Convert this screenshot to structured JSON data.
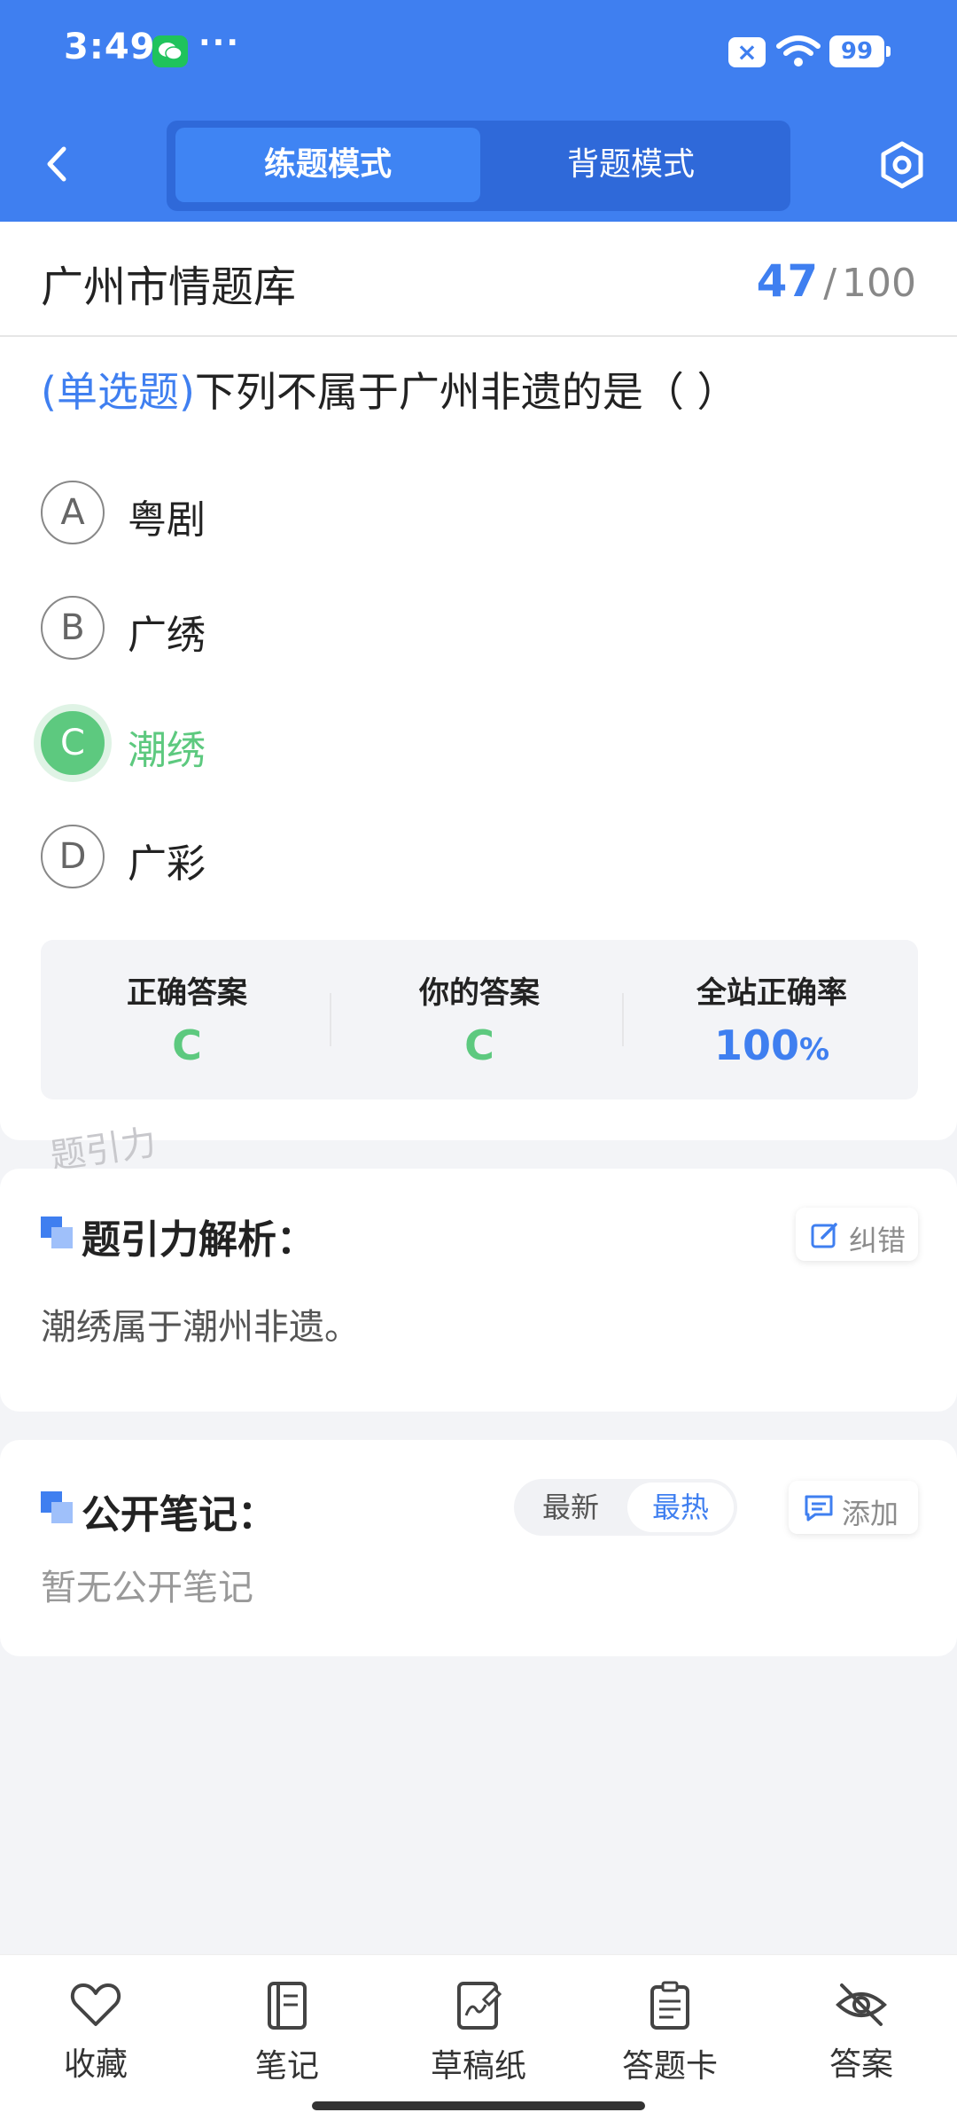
{
  "status_bar": {
    "time": "3:49",
    "more_dots": "···",
    "battery": "99",
    "icons": [
      "wechat-icon",
      "close-box-icon",
      "wifi-icon",
      "battery-icon"
    ]
  },
  "header": {
    "tabs": [
      {
        "label": "练题模式",
        "active": true
      },
      {
        "label": "背题模式",
        "active": false
      }
    ],
    "icons": [
      "back-arrow-icon",
      "settings-hexagon-icon"
    ],
    "accent_color": "#3f7ff0"
  },
  "bank": {
    "title": "广州市情题库",
    "current": "47",
    "separator": "/",
    "total": "100"
  },
  "question": {
    "type": "(单选题)",
    "text": "下列不属于广州非遗的是（        ）",
    "options": [
      {
        "letter": "A",
        "text": "粤剧",
        "state": "normal"
      },
      {
        "letter": "B",
        "text": "广绣",
        "state": "normal"
      },
      {
        "letter": "C",
        "text": "潮绣",
        "state": "correct"
      },
      {
        "letter": "D",
        "text": "广彩",
        "state": "normal"
      }
    ],
    "correct_color": "#5dc97f"
  },
  "result": {
    "correct_label": "正确答案",
    "correct_value": "C",
    "your_label": "你的答案",
    "your_value": "C",
    "rate_label": "全站正确率",
    "rate_value": "100",
    "rate_unit": "%"
  },
  "watermark": "题引力",
  "analysis": {
    "title": "题引力解析：",
    "report_button": "纠错",
    "text": "潮绣属于潮州非遗。"
  },
  "notes": {
    "title": "公开笔记：",
    "sort_options": [
      "最新",
      "最热"
    ],
    "sort_selected": "最热",
    "add_button": "添加",
    "empty_text": "暂无公开笔记"
  },
  "bottom_bar": {
    "items": [
      {
        "label": "收藏",
        "icon": "heart-icon"
      },
      {
        "label": "笔记",
        "icon": "notebook-icon"
      },
      {
        "label": "草稿纸",
        "icon": "draft-paper-icon"
      },
      {
        "label": "答题卡",
        "icon": "answer-card-icon"
      },
      {
        "label": "答案",
        "icon": "eye-off-icon"
      }
    ]
  }
}
